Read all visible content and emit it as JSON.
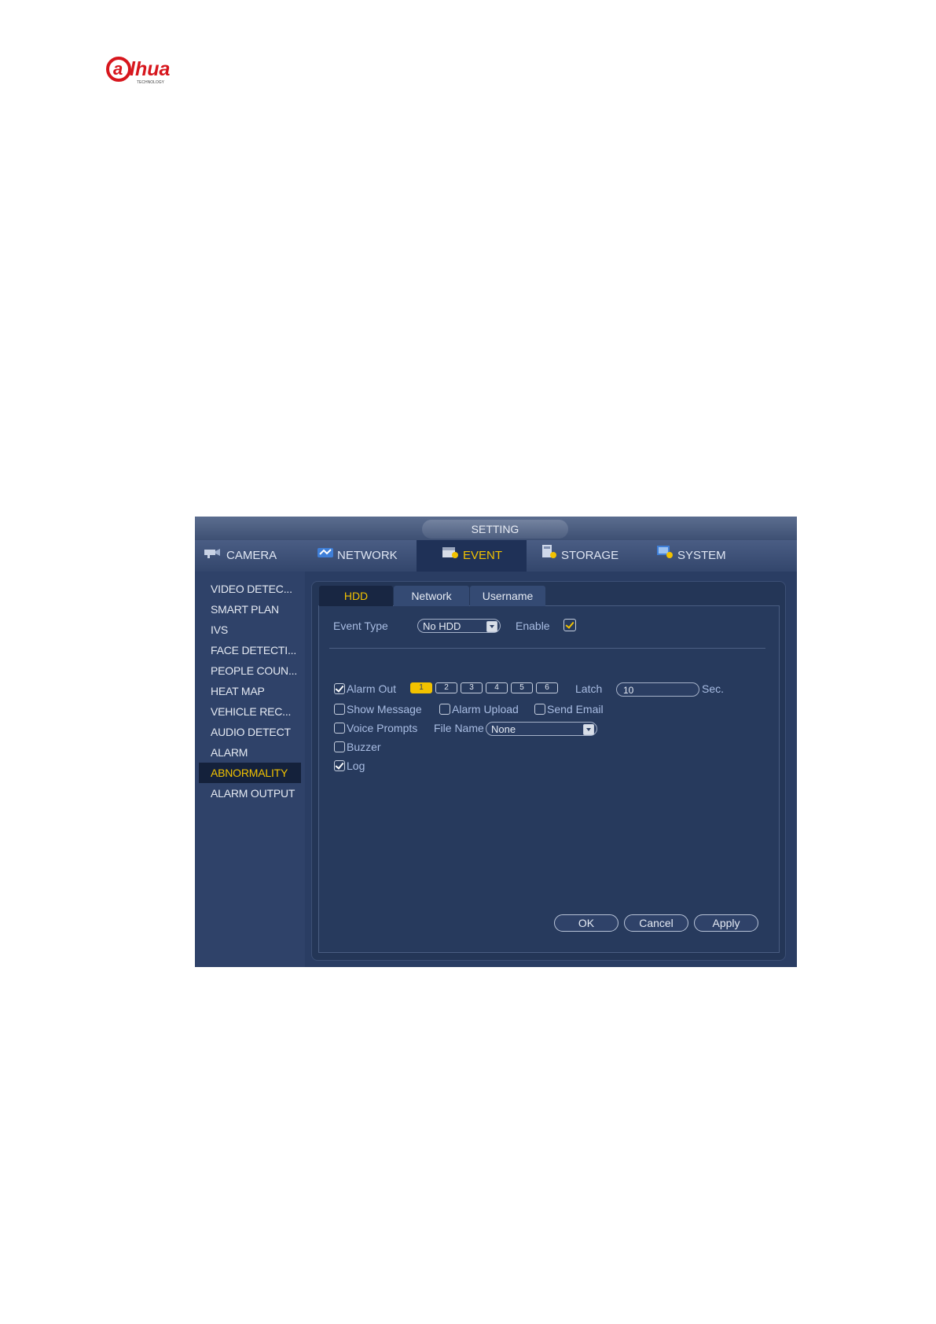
{
  "logo": {
    "text": "alhua",
    "subtext": "TECHNOLOGY"
  },
  "window": {
    "title": "SETTING"
  },
  "menu": [
    {
      "label": "CAMERA",
      "icon": "camera-icon"
    },
    {
      "label": "NETWORK",
      "icon": "network-icon"
    },
    {
      "label": "EVENT",
      "icon": "event-icon"
    },
    {
      "label": "STORAGE",
      "icon": "storage-icon"
    },
    {
      "label": "SYSTEM",
      "icon": "system-icon"
    }
  ],
  "sidebar": {
    "items": [
      {
        "label": "VIDEO DETEC..."
      },
      {
        "label": "SMART PLAN"
      },
      {
        "label": "IVS"
      },
      {
        "label": "FACE DETECTI..."
      },
      {
        "label": "PEOPLE COUN..."
      },
      {
        "label": "HEAT MAP"
      },
      {
        "label": "VEHICLE REC..."
      },
      {
        "label": "AUDIO DETECT"
      },
      {
        "label": "ALARM"
      },
      {
        "label": "ABNORMALITY"
      },
      {
        "label": "ALARM OUTPUT"
      }
    ],
    "active": "ABNORMALITY"
  },
  "tabs": [
    {
      "label": "HDD"
    },
    {
      "label": "Network"
    },
    {
      "label": "Username"
    }
  ],
  "form": {
    "event_type_label": "Event Type",
    "event_type_value": "No HDD",
    "enable_label": "Enable",
    "enable_checked": true,
    "alarm_out_label": "Alarm Out",
    "alarm_out_checked": true,
    "alarm_channels": [
      "1",
      "2",
      "3",
      "4",
      "5",
      "6"
    ],
    "latch_label": "Latch",
    "latch_value": "10",
    "latch_unit": "Sec.",
    "show_message_label": "Show Message",
    "show_message_checked": false,
    "alarm_upload_label": "Alarm Upload",
    "alarm_upload_checked": false,
    "send_email_label": "Send Email",
    "send_email_checked": false,
    "voice_prompts_label": "Voice Prompts",
    "voice_prompts_checked": false,
    "file_name_label": "File Name",
    "file_name_value": "None",
    "buzzer_label": "Buzzer",
    "buzzer_checked": false,
    "log_label": "Log",
    "log_checked": true
  },
  "buttons": {
    "ok": "OK",
    "cancel": "Cancel",
    "apply": "Apply"
  },
  "colors": {
    "accent": "#f2c200",
    "window_bg": "#2a3d63",
    "logo_red": "#d7161d"
  }
}
